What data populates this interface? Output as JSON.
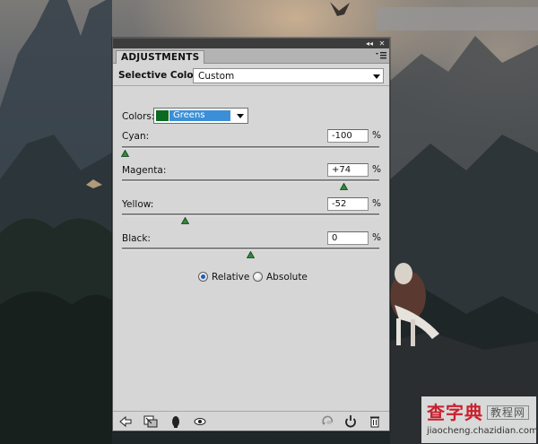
{
  "panel": {
    "tab_label": "ADJUSTMENTS",
    "adjustment_name": "Selective Color",
    "preset_value": "Custom",
    "colors_label": "Colors:",
    "colors_value": "Greens",
    "colors_swatch": "#0b6a21",
    "sliders": [
      {
        "label": "Cyan:",
        "value": "-100",
        "unit": "%",
        "level_percent": -100
      },
      {
        "label": "Magenta:",
        "value": "+74",
        "unit": "%",
        "level_percent": 74
      },
      {
        "label": "Yellow:",
        "value": "-52",
        "unit": "%",
        "level_percent": -52
      },
      {
        "label": "Black:",
        "value": "0",
        "unit": "%",
        "level_percent": 0
      }
    ],
    "method": {
      "relative_label": "Relative",
      "absolute_label": "Absolute",
      "selected": "Relative"
    },
    "icons": [
      "back-arrow-icon",
      "clip-to-layer-icon",
      "toggle-visibility-icon",
      "view-previous-state-icon",
      "reset-icon",
      "trash-icon",
      "mask-icon"
    ]
  },
  "watermark": {
    "main": "查字典",
    "net": "教程网",
    "url": "jiaocheng.chazidian.com"
  },
  "colors": {
    "accent": "#3b8fd6",
    "slider_thumb": "#2e8a3a"
  }
}
